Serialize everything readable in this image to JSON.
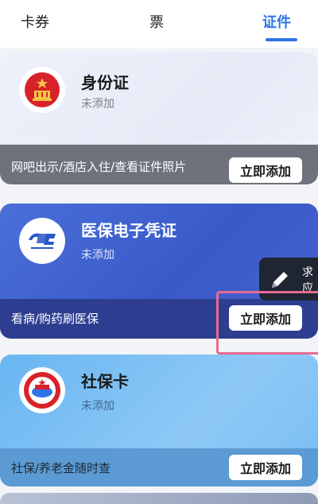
{
  "tabs": [
    {
      "label": "卡券"
    },
    {
      "label": "票"
    },
    {
      "label": "证件"
    }
  ],
  "cards": [
    {
      "title": "身份证",
      "status": "未添加",
      "description": "网吧出示/酒店入住/查看证件照片",
      "button": "立即添加"
    },
    {
      "title": "医保电子凭证",
      "status": "未添加",
      "description": "看病/购药刷医保",
      "button": "立即添加"
    },
    {
      "title": "社保卡",
      "status": "未添加",
      "description": "社保/养老金随时查",
      "button": "立即添加"
    }
  ],
  "float_button": {
    "line1": "求",
    "line2": "应",
    "icon": "pen-icon"
  },
  "colors": {
    "accent": "#2f74e6",
    "highlight": "#e86a8f"
  }
}
